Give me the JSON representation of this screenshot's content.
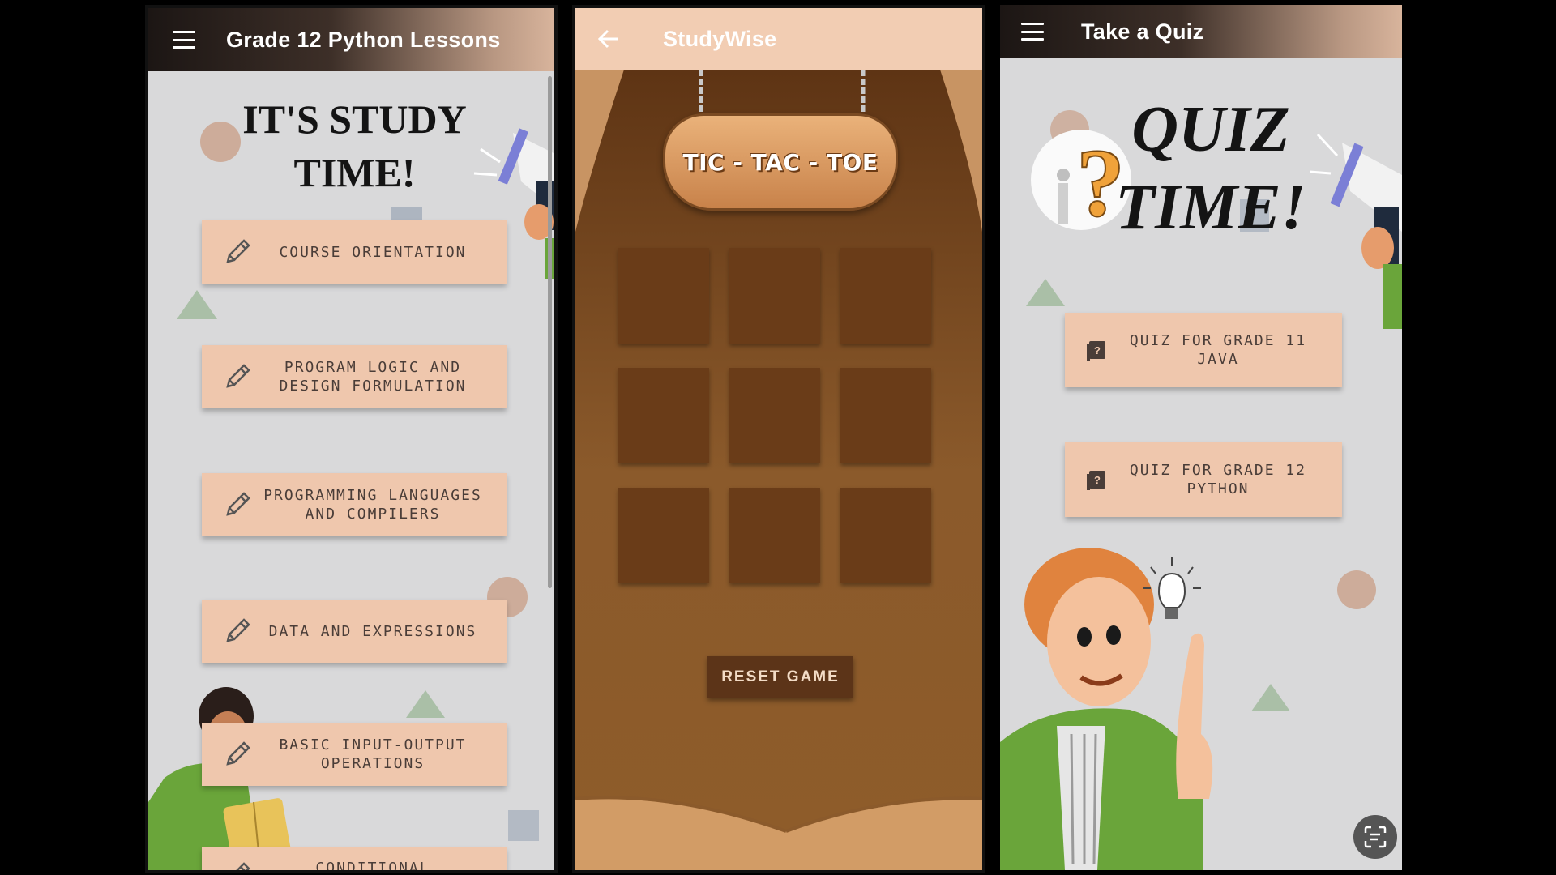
{
  "colors": {
    "accent": "#efc7ad",
    "button_text": "#4a3d38",
    "wood_dark": "#6a3c18",
    "wood_mid": "#8b5a2b",
    "reset": "#5c3418"
  },
  "lessons_screen": {
    "title": "Grade 12 Python Lessons",
    "heading_line1": "IT'S STUDY",
    "heading_line2": "TIME!",
    "lessons": [
      {
        "label": "COURSE ORIENTATION",
        "icon": "pencil-icon"
      },
      {
        "label": "PROGRAM LOGIC AND DESIGN FORMULATION",
        "icon": "pencil-icon"
      },
      {
        "label": "PROGRAMMING LANGUAGES AND COMPILERS",
        "icon": "pencil-icon"
      },
      {
        "label": "DATA AND EXPRESSIONS",
        "icon": "pencil-icon"
      },
      {
        "label": "BASIC INPUT-OUTPUT OPERATIONS",
        "icon": "pencil-icon"
      },
      {
        "label": "CONDITIONAL",
        "icon": "pencil-icon"
      }
    ]
  },
  "game_screen": {
    "title": "StudyWise",
    "sign_text": "TIC - TAC - TOE",
    "board": [
      "",
      "",
      "",
      "",
      "",
      "",
      "",
      "",
      ""
    ],
    "reset_label": "RESET GAME"
  },
  "quiz_screen": {
    "title": "Take a Quiz",
    "heading_line1": "QUIZ",
    "heading_line2": "TIME!",
    "quizzes": [
      {
        "label": "QUIZ FOR GRADE 11 JAVA",
        "icon": "quiz-book-icon"
      },
      {
        "label": "QUIZ FOR GRADE 12 PYTHON",
        "icon": "quiz-book-icon"
      }
    ]
  }
}
